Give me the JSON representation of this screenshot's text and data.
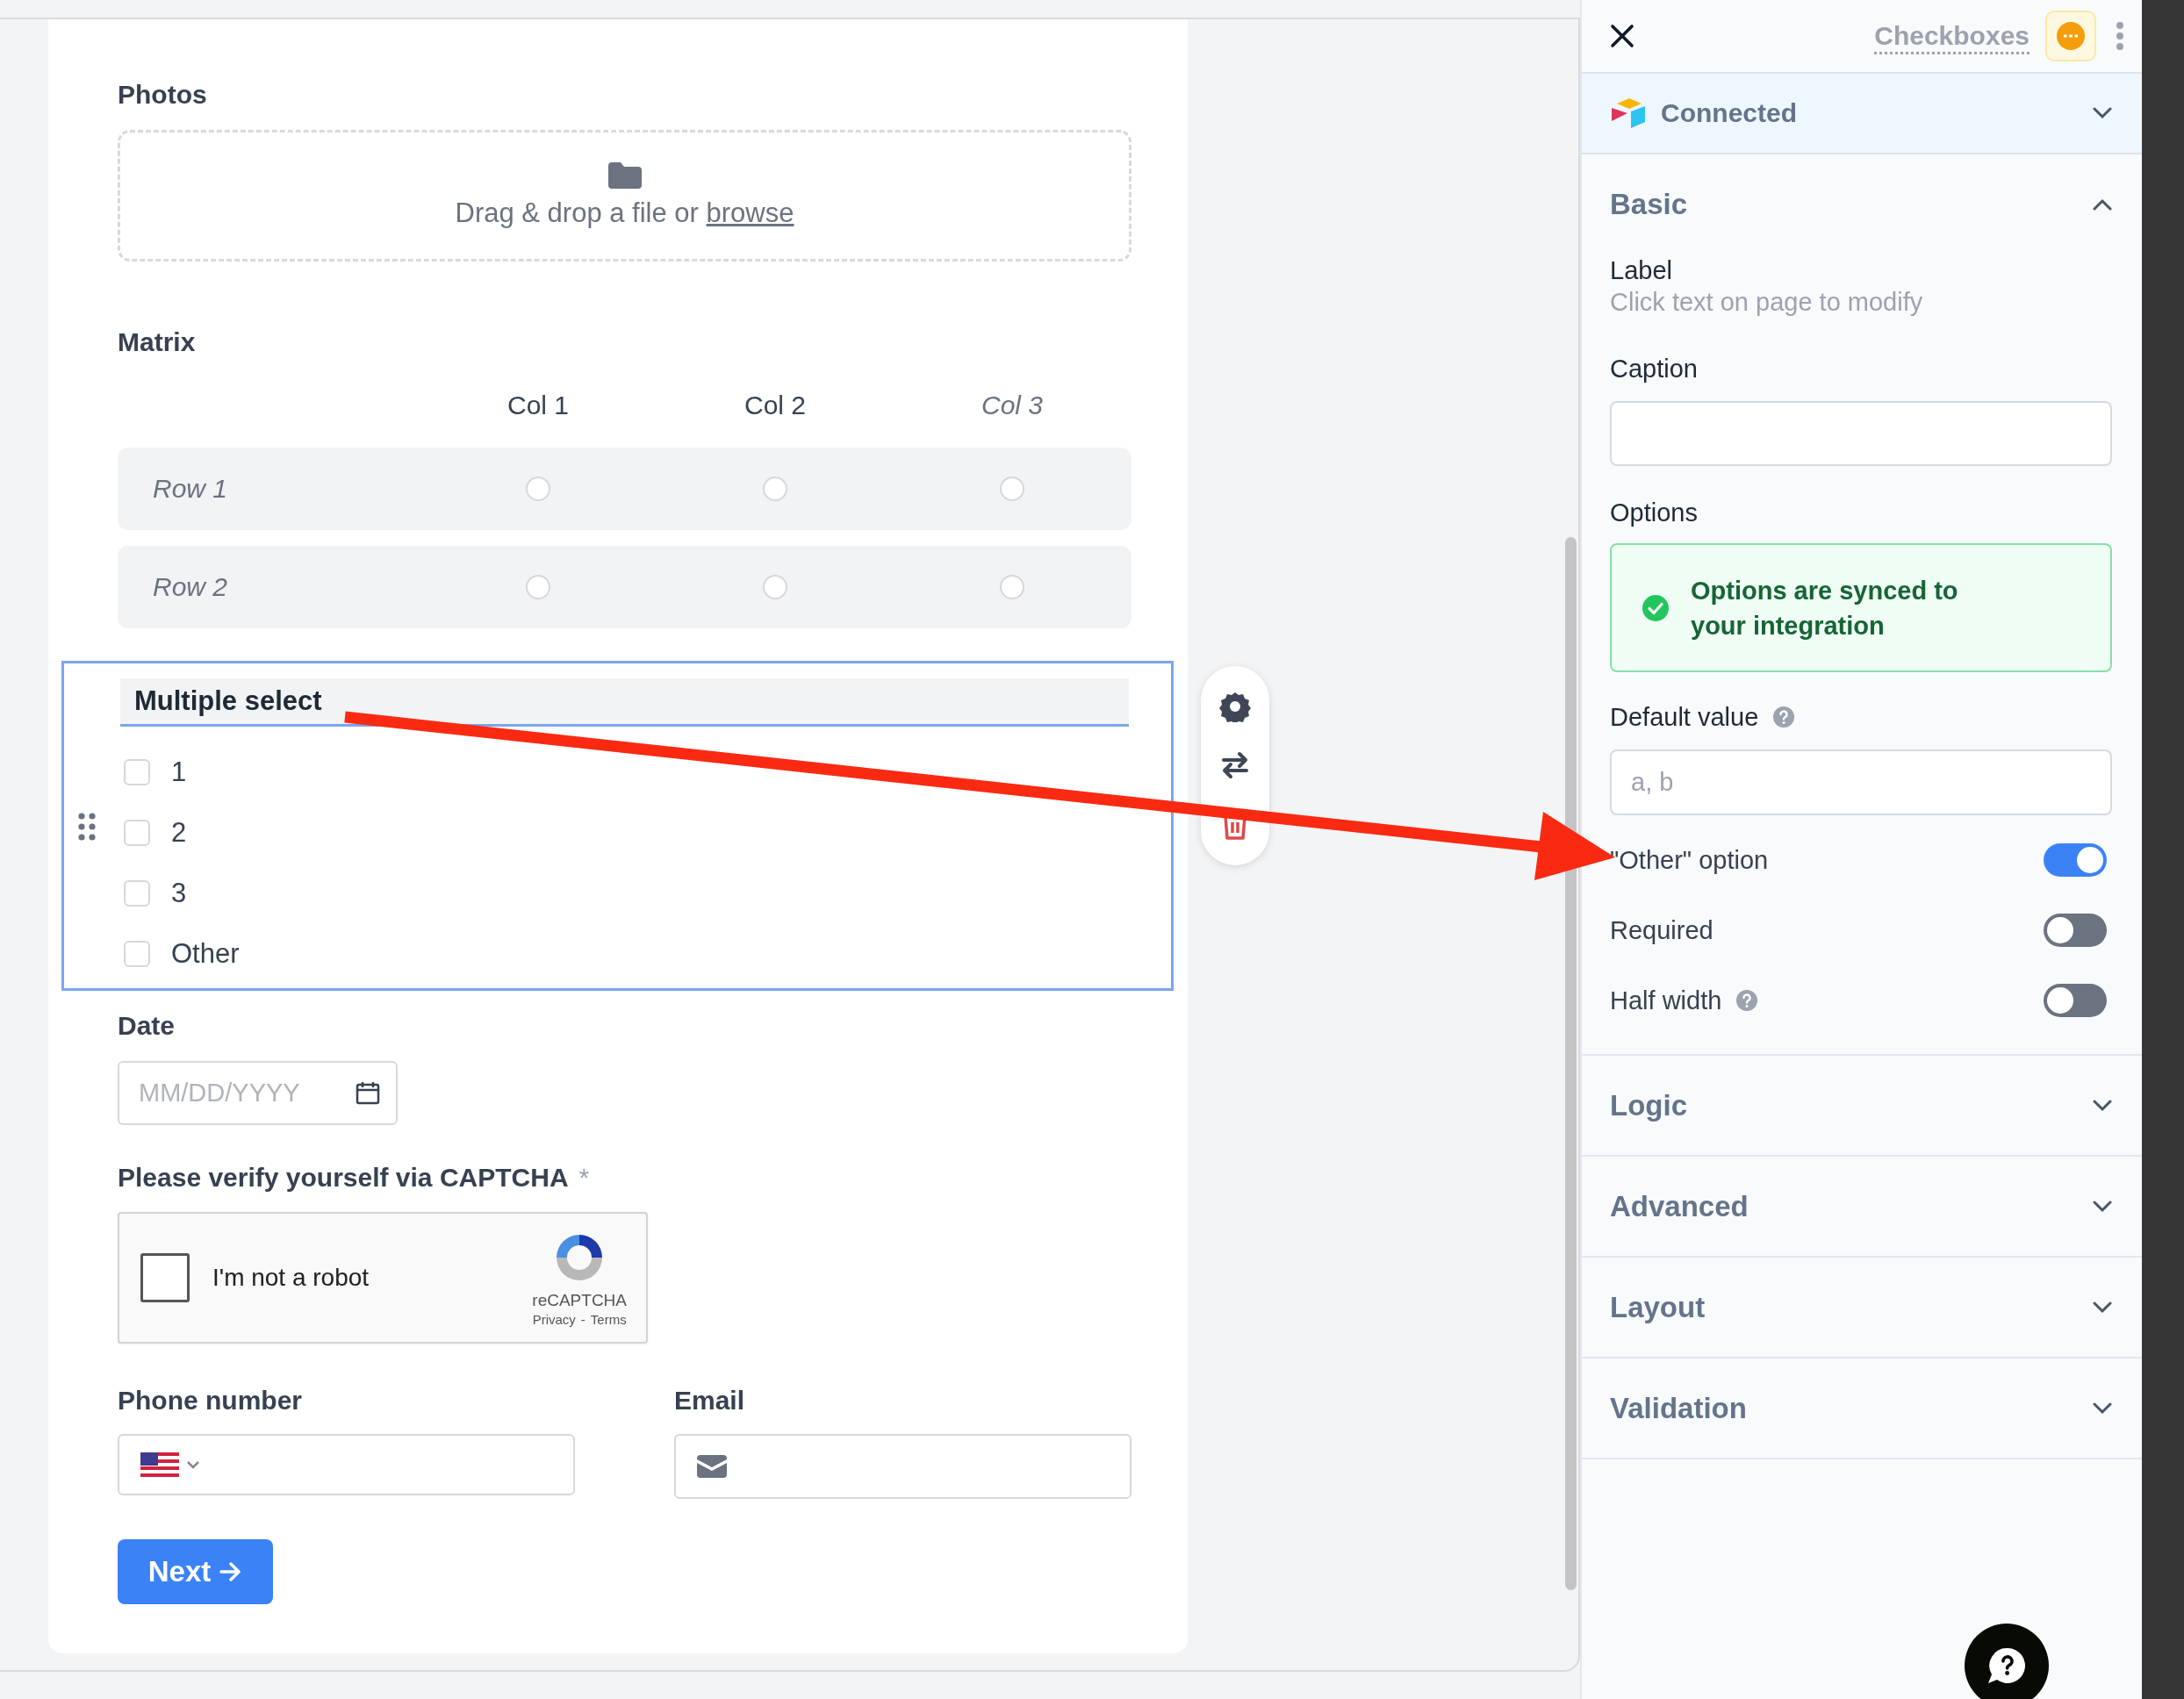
{
  "form": {
    "photos": {
      "label": "Photos",
      "dropzone_text": "Drag & drop a file or",
      "browse_link": "browse"
    },
    "matrix": {
      "label": "Matrix",
      "columns": [
        {
          "label": "Col 1",
          "placeholder": false
        },
        {
          "label": "Col 2",
          "placeholder": false
        },
        {
          "label": "Col 3",
          "placeholder": true
        }
      ],
      "rows": [
        {
          "label": "Row 1",
          "placeholder": true,
          "choices": [
            {
              "selected": false
            },
            {
              "selected": false
            },
            {
              "selected": false
            }
          ]
        },
        {
          "label": "Row 2",
          "placeholder": true,
          "choices": [
            {
              "selected": false
            },
            {
              "selected": false
            },
            {
              "selected": false
            }
          ]
        }
      ]
    },
    "multiple_select": {
      "label": "Multiple select",
      "selected": true,
      "options": [
        {
          "label": "1",
          "checked": false
        },
        {
          "label": "2",
          "checked": false
        },
        {
          "label": "3",
          "checked": false
        },
        {
          "label": "Other",
          "checked": false
        }
      ]
    },
    "date": {
      "label": "Date",
      "placeholder": "MM/DD/YYYY"
    },
    "captcha": {
      "label": "Please verify yourself via CAPTCHA",
      "required_mark": "*",
      "checkbox_label": "I'm not a robot",
      "checked": false,
      "brand": "reCAPTCHA",
      "privacy": "Privacy",
      "separator": "-",
      "terms": "Terms"
    },
    "phone": {
      "label": "Phone number"
    },
    "email": {
      "label": "Email"
    },
    "next_button": "Next"
  },
  "panel": {
    "title": "Checkboxes",
    "integration": {
      "label": "Connected",
      "expanded": false
    },
    "sections": [
      {
        "title": "Basic",
        "expanded": true
      },
      {
        "title": "Logic",
        "expanded": false
      },
      {
        "title": "Advanced",
        "expanded": false
      },
      {
        "title": "Layout",
        "expanded": false
      },
      {
        "title": "Validation",
        "expanded": false
      }
    ],
    "basic": {
      "label_heading": "Label",
      "label_hint": "Click text on page to modify",
      "caption": {
        "label": "Caption"
      },
      "options": {
        "label": "Options",
        "notice": "Options are synced to your integration"
      },
      "default_value": {
        "label": "Default value",
        "help": true,
        "placeholder": "a, b"
      },
      "toggles": [
        {
          "label": "\"Other\" option",
          "on": true,
          "help": false
        },
        {
          "label": "Required",
          "on": false,
          "help": false
        },
        {
          "label": "Half width",
          "on": false,
          "help": true
        }
      ]
    }
  }
}
